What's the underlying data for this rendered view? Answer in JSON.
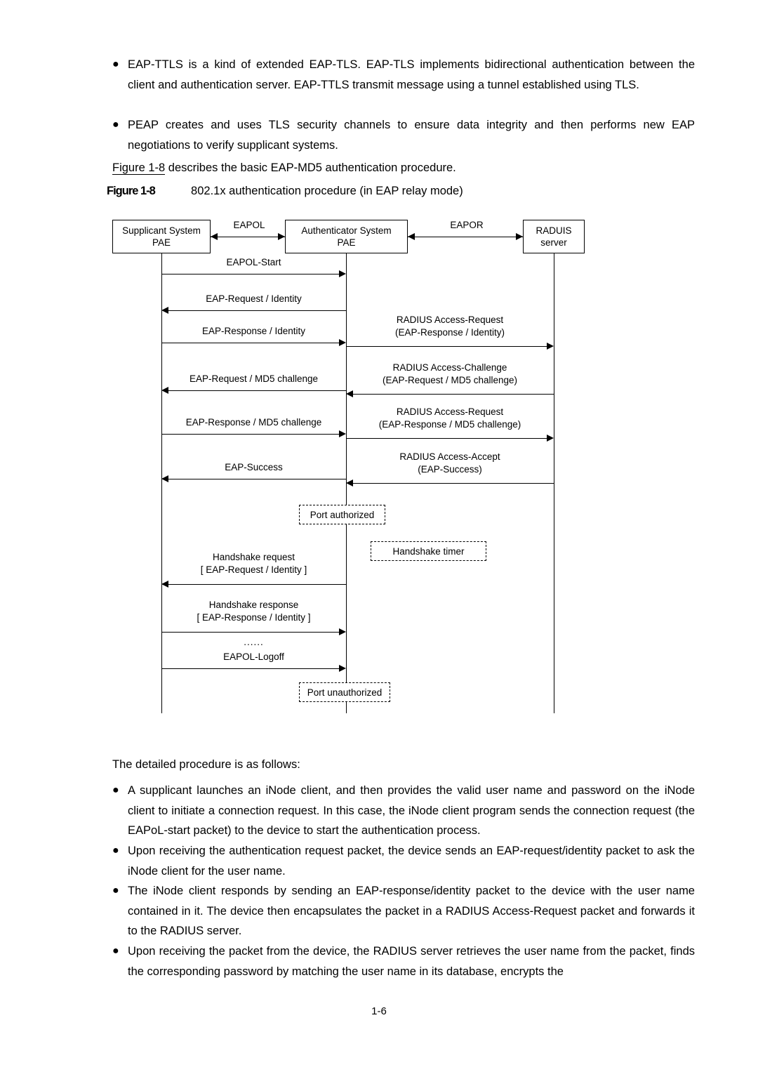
{
  "body": {
    "bullets_top": [
      "EAP-TTLS is a kind of extended EAP-TLS. EAP-TLS implements bidirectional authentication between the client and authentication server. EAP-TTLS transmit message using a tunnel established using TLS.",
      "PEAP creates and uses TLS security channels to ensure data integrity and then performs new EAP negotiations to verify supplicant systems."
    ],
    "figure_sentence_ref": "Figure 1-8",
    "figure_sentence_rest": " describes the basic EAP-MD5 authentication procedure.",
    "figure_caption_label": "Figure 1-8",
    "figure_caption_text": "802.1x authentication procedure (in EAP relay mode)",
    "detailed_intro": "The detailed procedure is as follows:",
    "bullets_bottom": [
      "A supplicant launches an iNode client, and then provides the valid user name and password on the iNode client to initiate a connection request. In this case, the iNode client program sends the connection request (the EAPoL-start packet) to the device to start the authentication process.",
      "Upon receiving the authentication request packet, the device sends an EAP-request/identity packet to ask the iNode client for the user name.",
      "The iNode client responds by sending an EAP-response/identity packet to the device with the user name contained in it. The device then encapsulates the packet in a RADIUS Access-Request packet and forwards it to the RADIUS server.",
      "Upon receiving the packet from the device, the RADIUS server retrieves the user name from the packet, finds the corresponding password by matching the user name in its database, encrypts the"
    ],
    "page_number": "1-6"
  },
  "diagram": {
    "nodes": [
      {
        "line1": "Supplicant System",
        "line2": "PAE"
      },
      {
        "line1": "Authenticator System",
        "line2": "PAE"
      },
      {
        "line1": "RADUIS",
        "line2": "server"
      }
    ],
    "link_labels": [
      "EAPOL",
      "EAPOR"
    ],
    "messages_left": [
      {
        "text": "EAPOL-Start",
        "dir": "right"
      },
      {
        "text": "EAP-Request / Identity",
        "dir": "left"
      },
      {
        "text": "EAP-Response / Identity",
        "dir": "right"
      },
      {
        "text": "EAP-Request / MD5 challenge",
        "dir": "left"
      },
      {
        "text": "EAP-Response / MD5 challenge",
        "dir": "right"
      },
      {
        "text": "EAP-Success",
        "dir": "left"
      },
      {
        "text": "Handshake request\n[ EAP-Request / Identity ]",
        "dir": "left"
      },
      {
        "text": "Handshake response\n[ EAP-Response / Identity ]",
        "dir": "right"
      },
      {
        "text": "EAPOL-Logoff",
        "dir": "right"
      }
    ],
    "messages_right": [
      {
        "text": "RADIUS Access-Request\n(EAP-Response / Identity)",
        "dir": "right"
      },
      {
        "text": "RADIUS Access-Challenge\n(EAP-Request / MD5 challenge)",
        "dir": "left"
      },
      {
        "text": "RADIUS Access-Request\n(EAP-Response / MD5 challenge)",
        "dir": "right"
      },
      {
        "text": "RADIUS Access-Accept\n(EAP-Success)",
        "dir": "left"
      }
    ],
    "state_boxes": [
      "Port authorized",
      "Handshake timer",
      "Port unauthorized"
    ],
    "ellipsis": "......"
  }
}
